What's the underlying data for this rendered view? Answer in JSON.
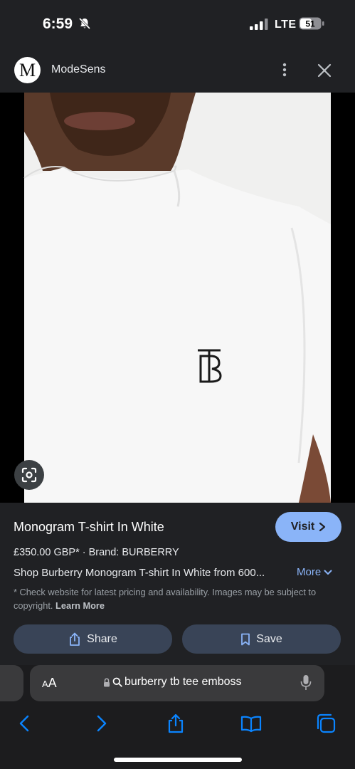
{
  "status_bar": {
    "time": "6:59",
    "network": "LTE",
    "battery": "51",
    "icons": [
      "bell-slash-icon",
      "signal-icon",
      "battery-icon"
    ]
  },
  "source": {
    "logo_letter": "M",
    "name": "ModeSens"
  },
  "product": {
    "title": "Monogram T-shirt In White",
    "visit_label": "Visit",
    "price": "£350.00 GBP*",
    "brand": "Brand: BURBERRY",
    "description": "Shop Burberry Monogram T-shirt In White from 600...",
    "more_label": "More",
    "disclaimer": "* Check website for latest pricing and availability. Images may be subject to copyright.",
    "learn_more": "Learn More",
    "share_label": "Share",
    "save_label": "Save"
  },
  "browser": {
    "aa_small": "A",
    "aa_big": "A",
    "address": "burberry tb tee emboss"
  },
  "colors": {
    "accent": "#8ab4f8",
    "background": "#202124",
    "button_bg": "#394457",
    "nav_blue": "#0a84ff"
  }
}
